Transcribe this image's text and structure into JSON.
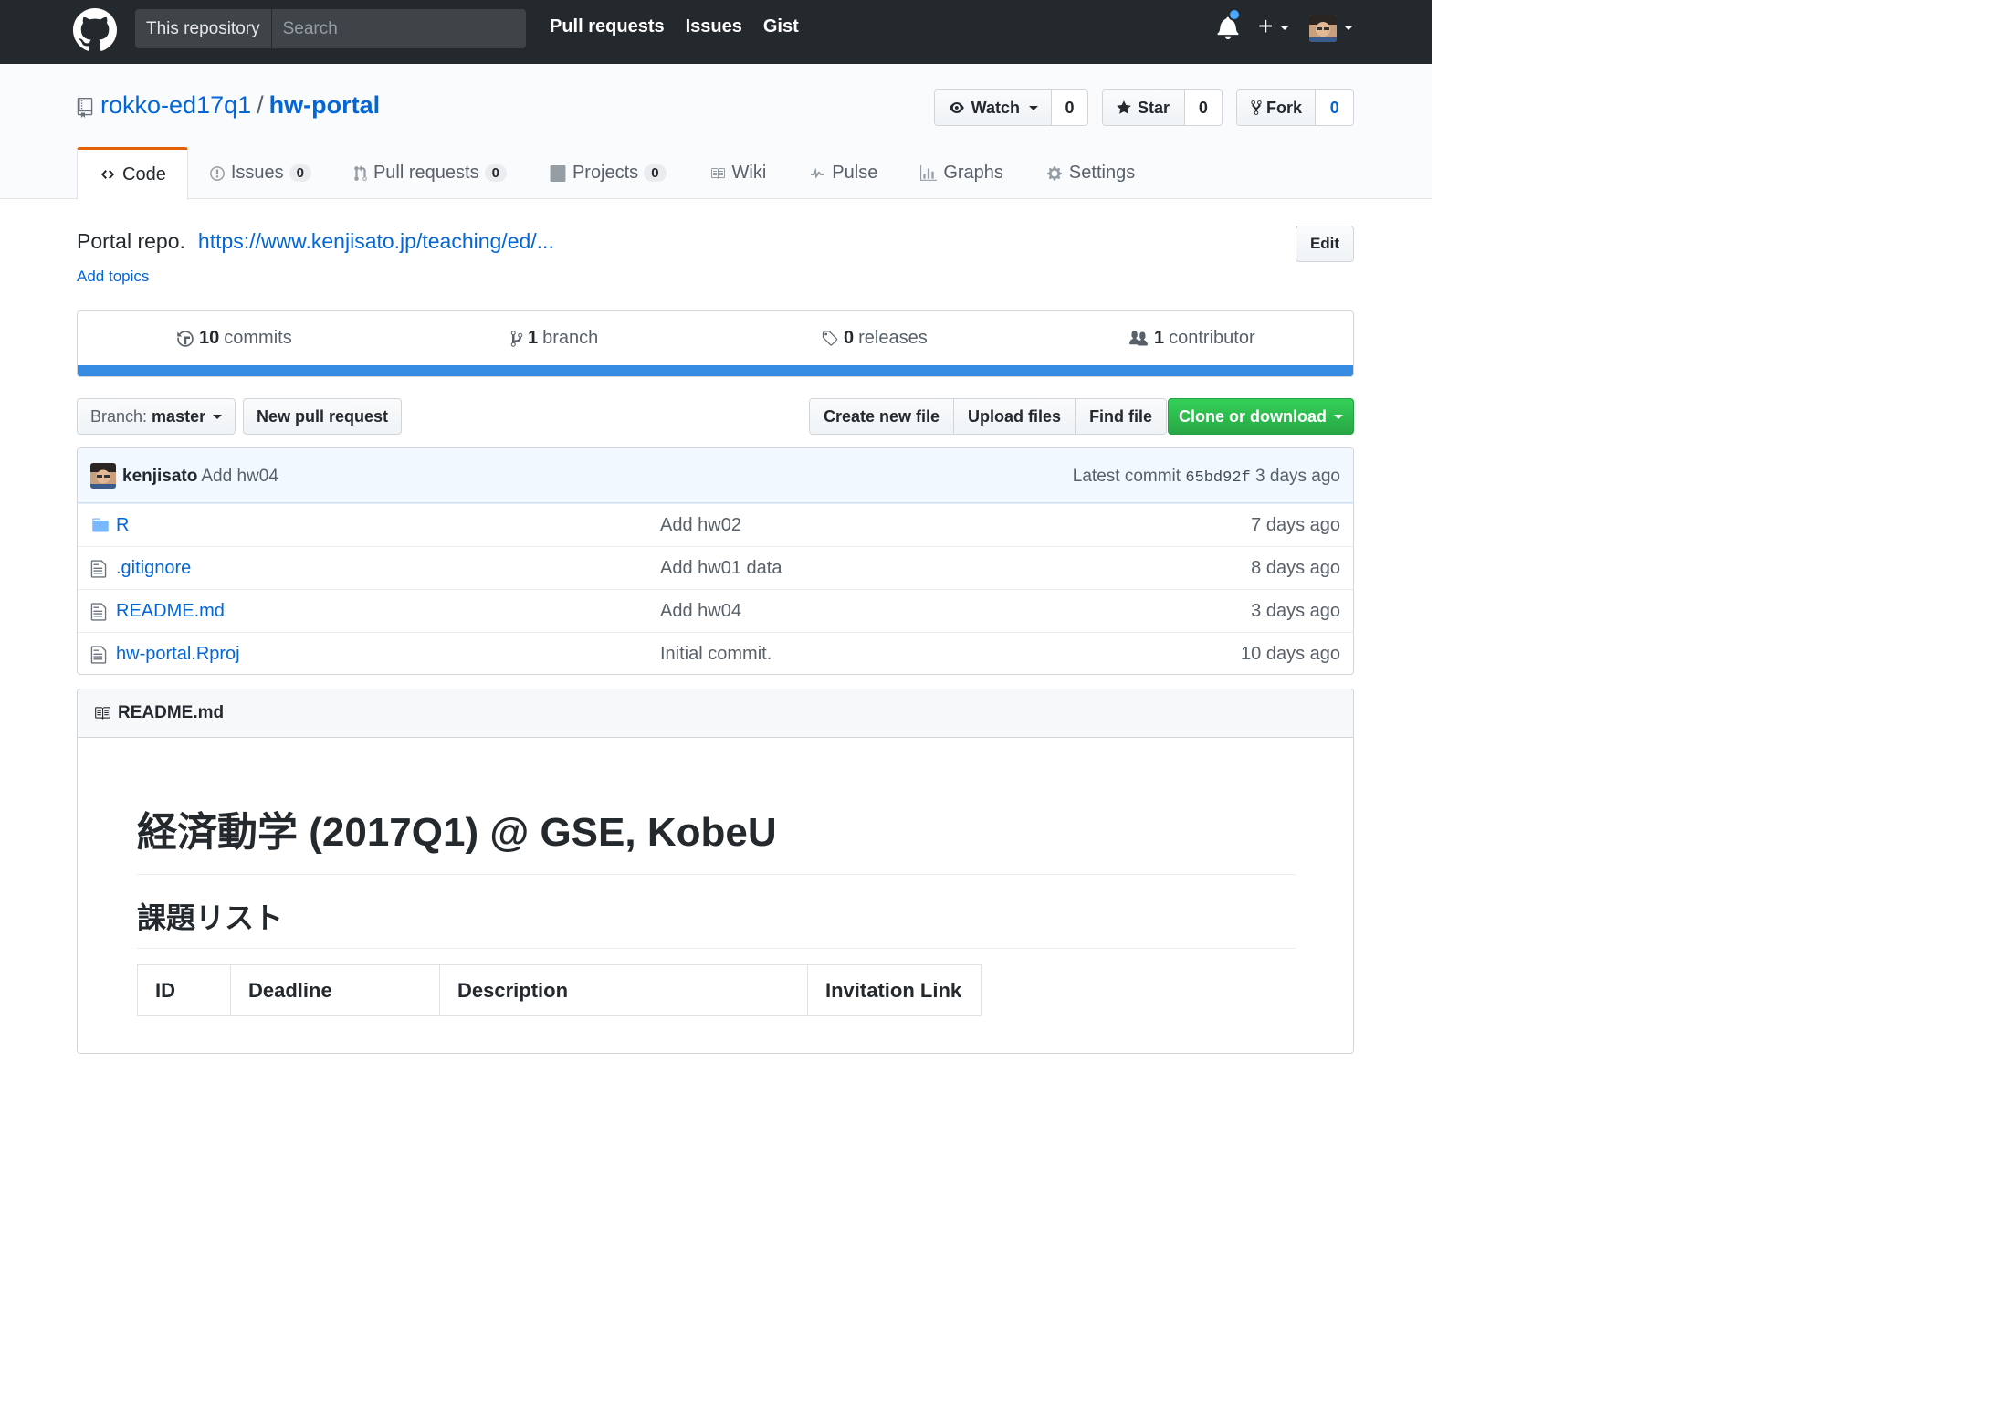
{
  "header": {
    "search_scope": "This repository",
    "search_placeholder": "Search",
    "nav": [
      "Pull requests",
      "Issues",
      "Gist"
    ]
  },
  "repo": {
    "owner": "rokko-ed17q1",
    "separator": "/",
    "name": "hw-portal",
    "watch": {
      "label": "Watch",
      "count": "0"
    },
    "star": {
      "label": "Star",
      "count": "0"
    },
    "fork": {
      "label": "Fork",
      "count": "0"
    }
  },
  "tabs": [
    {
      "label": "Code"
    },
    {
      "label": "Issues",
      "count": "0"
    },
    {
      "label": "Pull requests",
      "count": "0"
    },
    {
      "label": "Projects",
      "count": "0"
    },
    {
      "label": "Wiki"
    },
    {
      "label": "Pulse"
    },
    {
      "label": "Graphs"
    },
    {
      "label": "Settings"
    }
  ],
  "about": {
    "description": "Portal repo.",
    "url": "https://www.kenjisato.jp/teaching/ed/...",
    "add_topics": "Add topics",
    "edit": "Edit"
  },
  "summary": {
    "commits": {
      "num": "10",
      "label": "commits"
    },
    "branches": {
      "num": "1",
      "label": "branch"
    },
    "releases": {
      "num": "0",
      "label": "releases"
    },
    "contributors": {
      "num": "1",
      "label": "contributor"
    },
    "language_color": "#358ae1"
  },
  "filenav": {
    "branch_prefix": "Branch:",
    "branch": "master",
    "new_pr": "New pull request",
    "create": "Create new file",
    "upload": "Upload files",
    "find": "Find file",
    "clone": "Clone or download"
  },
  "commit": {
    "author": "kenjisato",
    "message": "Add hw04",
    "latest_prefix": "Latest commit",
    "sha": "65bd92f",
    "age": "3 days ago"
  },
  "files": [
    {
      "name": "R",
      "type": "folder",
      "message": "Add hw02",
      "age": "7 days ago"
    },
    {
      "name": ".gitignore",
      "type": "file",
      "message": "Add hw01 data",
      "age": "8 days ago"
    },
    {
      "name": "README.md",
      "type": "file",
      "message": "Add hw04",
      "age": "3 days ago"
    },
    {
      "name": "hw-portal.Rproj",
      "type": "file",
      "message": "Initial commit.",
      "age": "10 days ago"
    }
  ],
  "readme": {
    "filename": "README.md",
    "h1": "経済動学 (2017Q1) @ GSE, KobeU",
    "h2": "課題リスト",
    "table_headers": [
      "ID",
      "Deadline",
      "Description",
      "Invitation Link"
    ]
  },
  "colors": {
    "topbar": "#24292e",
    "link": "#0366d6",
    "tab_accent": "#e36209",
    "clone_green": "#28a745"
  }
}
